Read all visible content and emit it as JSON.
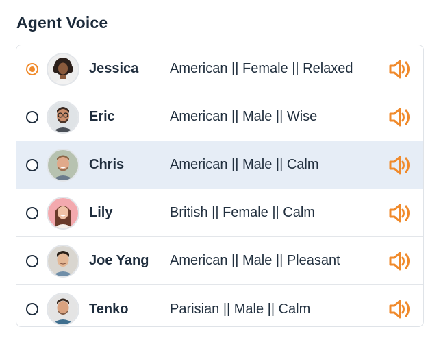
{
  "section": {
    "title": "Agent Voice"
  },
  "colors": {
    "accent": "#f08a2b",
    "highlight_row": "#e6edf6",
    "text": "#1f2d3d"
  },
  "voices": [
    {
      "name": "Jessica",
      "description": "American || Female || Relaxed",
      "selected": true,
      "avatar": "woman-curly-hair-avatar",
      "play_icon": "speaker-icon"
    },
    {
      "name": "Eric",
      "description": "American || Male || Wise",
      "selected": false,
      "avatar": "man-glasses-beard-avatar",
      "play_icon": "speaker-icon"
    },
    {
      "name": "Chris",
      "description": "American || Male || Calm",
      "selected": false,
      "avatar": "man-smiling-beard-avatar",
      "play_icon": "speaker-icon",
      "highlighted": true
    },
    {
      "name": "Lily",
      "description": "British || Female || Calm",
      "selected": false,
      "avatar": "woman-long-hair-avatar",
      "play_icon": "speaker-icon"
    },
    {
      "name": "Joe Yang",
      "description": "American || Male || Pleasant",
      "selected": false,
      "avatar": "man-short-hair-avatar",
      "play_icon": "speaker-icon"
    },
    {
      "name": "Tenko",
      "description": "Parisian || Male || Calm",
      "selected": false,
      "avatar": "man-stubble-avatar",
      "play_icon": "speaker-icon"
    }
  ]
}
